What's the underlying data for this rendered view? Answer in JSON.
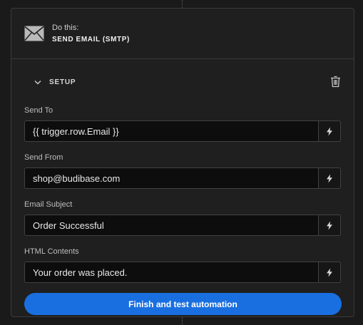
{
  "step": {
    "kicker": "Do this:",
    "title": "SEND EMAIL (SMTP)",
    "icon": "mail-icon"
  },
  "setup": {
    "label": "SETUP",
    "expand_icon": "chevron-down-icon",
    "delete_icon": "trash-icon"
  },
  "fields": [
    {
      "label": "Send To",
      "value": "{{ trigger.row.Email }}",
      "bind_icon": "lightning-icon"
    },
    {
      "label": "Send From",
      "value": "shop@budibase.com",
      "bind_icon": "lightning-icon"
    },
    {
      "label": "Email Subject",
      "value": "Order Successful",
      "bind_icon": "lightning-icon"
    },
    {
      "label": "HTML Contents",
      "value": "Your order was placed.",
      "bind_icon": "lightning-icon"
    }
  ],
  "actions": {
    "finish_label": "Finish and test automation"
  },
  "colors": {
    "primary": "#1a6fe0",
    "background": "#1a1a1a",
    "card": "#1f1f1f",
    "input": "#0d0d0d"
  }
}
